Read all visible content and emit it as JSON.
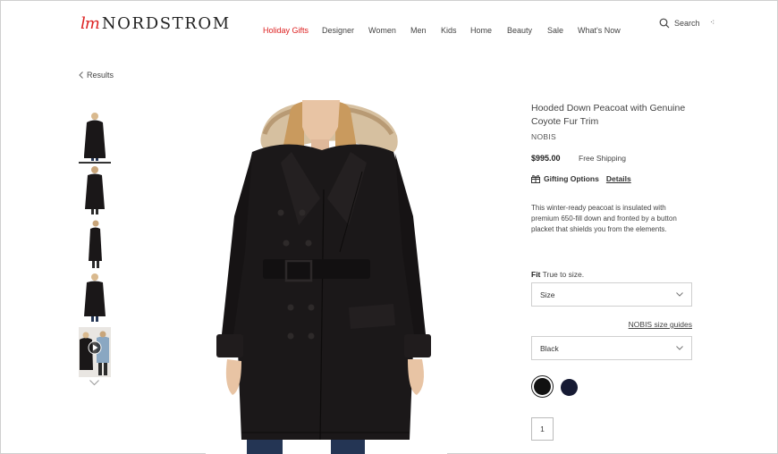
{
  "brand": {
    "script": "lm",
    "word": "NORDSTROM",
    "accent_color": "#dd2222"
  },
  "nav": [
    {
      "label": "Holiday Gifts",
      "highlight": true
    },
    {
      "label": "Designer"
    },
    {
      "label": "Women"
    },
    {
      "label": "Men"
    },
    {
      "label": "Kids"
    },
    {
      "label": "Home"
    },
    {
      "label": "Beauty"
    },
    {
      "label": "Sale"
    },
    {
      "label": "What's Now"
    }
  ],
  "search": {
    "label": "Search",
    "icon": "search-icon"
  },
  "more_glyph": "⁖",
  "breadcrumb": {
    "label": "Results",
    "icon": "chevron-left-icon"
  },
  "thumbnails": {
    "count": 5,
    "selected_index": 0,
    "last_is_video": true,
    "scroll_icon": "chevron-down-icon"
  },
  "product": {
    "title": "Hooded Down Peacoat with Genuine Coyote Fur Trim",
    "brand": "NOBIS",
    "price": "$995.00",
    "shipping": "Free Shipping",
    "gifting": {
      "label": "Gifting Options",
      "details": "Details",
      "icon": "gift-icon"
    },
    "description": "This winter-ready peacoat is insulated with premium 650-fill down and fronted by a button placket that shields you from the elements.",
    "fit_label": "Fit",
    "fit_value": "True to size.",
    "size_select": {
      "value": "Size"
    },
    "size_guide_link": "NOBIS size guides",
    "color_select": {
      "value": "Black"
    },
    "swatches": [
      {
        "name": "Black",
        "color": "#111111",
        "selected": true
      },
      {
        "name": "Navy",
        "color": "#161a33",
        "selected": false
      }
    ],
    "quantity": "1"
  }
}
